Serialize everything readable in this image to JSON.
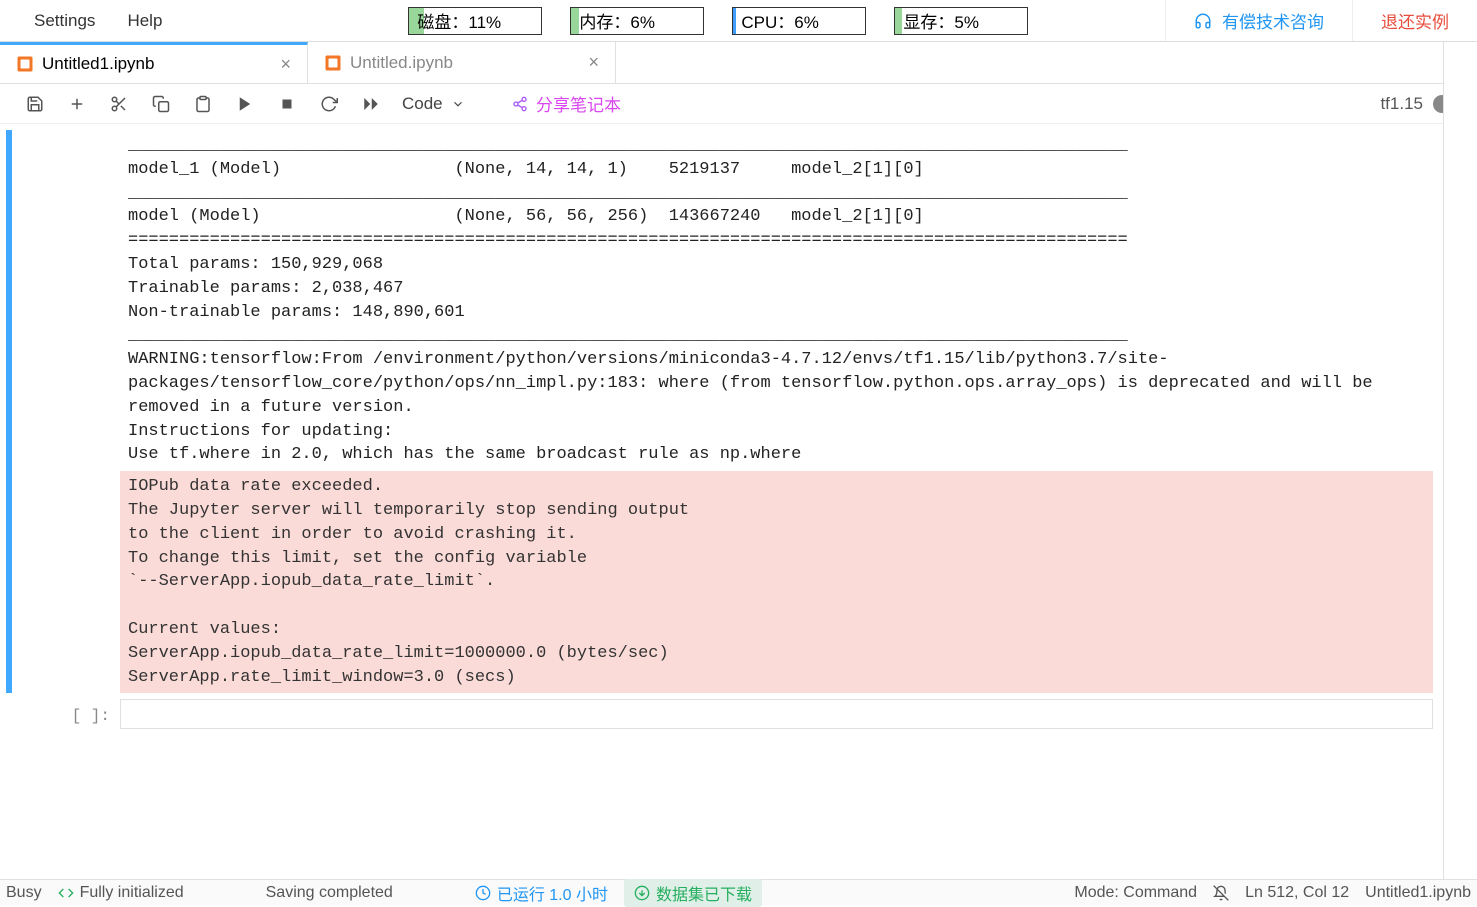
{
  "menus": {
    "settings": "Settings",
    "help": "Help"
  },
  "stats": {
    "disk": "磁盘：11%",
    "mem": "内存：6%",
    "cpu": "CPU：6%",
    "gpu": "显存：5%"
  },
  "topbar_links": {
    "consult": "有偿技术咨询",
    "return": "退还实例"
  },
  "tabs": [
    {
      "label": "Untitled1.ipynb",
      "active": true
    },
    {
      "label": "Untitled.ipynb",
      "active": false
    }
  ],
  "toolbar": {
    "cell_type": "Code",
    "share": "分享笔记本",
    "kernel": "tf1.15"
  },
  "output_lines": "__________________________________________________________________________________________________\nmodel_1 (Model)                 (None, 14, 14, 1)    5219137     model_2[1][0]                    \n__________________________________________________________________________________________________\nmodel (Model)                   (None, 56, 56, 256)  143667240   model_2[1][0]                    \n==================================================================================================\nTotal params: 150,929,068\nTrainable params: 2,038,467\nNon-trainable params: 148,890,601\n__________________________________________________________________________________________________\nWARNING:tensorflow:From /environment/python/versions/miniconda3-4.7.12/envs/tf1.15/lib/python3.7/site-packages/tensorflow_core/python/ops/nn_impl.py:183: where (from tensorflow.python.ops.array_ops) is deprecated and will be removed in a future version.\nInstructions for updating:\nUse tf.where in 2.0, which has the same broadcast rule as np.where",
  "error_lines": "IOPub data rate exceeded.\nThe Jupyter server will temporarily stop sending output\nto the client in order to avoid crashing it.\nTo change this limit, set the config variable\n`--ServerApp.iopub_data_rate_limit`.\n\nCurrent values:\nServerApp.iopub_data_rate_limit=1000000.0 (bytes/sec)\nServerApp.rate_limit_window=3.0 (secs)\n",
  "empty_prompt": "[ ]:",
  "statusbar": {
    "busy": "Busy",
    "init": "Fully initialized",
    "saving": "Saving completed",
    "runtime": "已运行 1.0 小时",
    "dataset": "数据集已下载",
    "mode": "Mode: Command",
    "pos": "Ln 512, Col 12",
    "file": "Untitled1.ipynb"
  }
}
